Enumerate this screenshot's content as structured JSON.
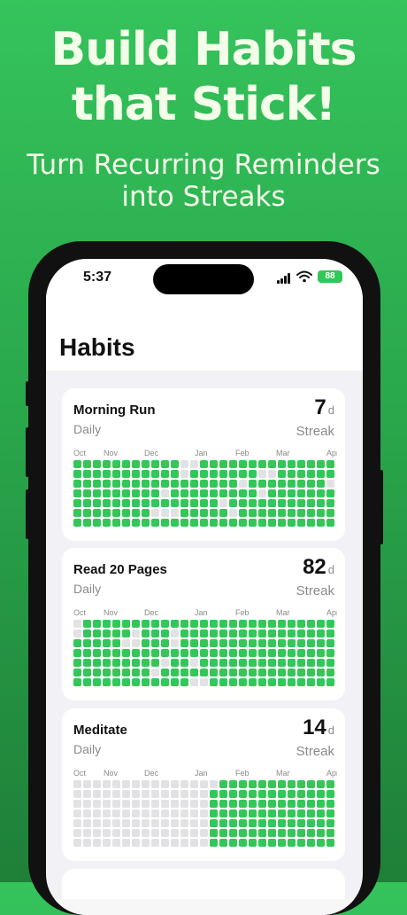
{
  "promo": {
    "headline_line1": "Build Habits",
    "headline_line2": "that Stick!",
    "subhead_line1": "Turn Recurring Reminders",
    "subhead_line2": "into Streaks"
  },
  "status_bar": {
    "time": "5:37",
    "battery": "88",
    "icons": [
      "cellular-signal-icon",
      "wifi-icon",
      "battery-icon"
    ]
  },
  "screen": {
    "title": "Habits"
  },
  "colors": {
    "accent": "#33c759",
    "empty_cell": "#e2e2e4",
    "background": "#2aa84c"
  },
  "month_labels": [
    "Oct",
    "Nov",
    "Dec",
    "Jan",
    "Feb",
    "Mar",
    "Apr"
  ],
  "habits": [
    {
      "name": "Morning Run",
      "frequency": "Daily",
      "streak_value": "7",
      "streak_unit": "d",
      "streak_label": "Streak",
      "grid": [
        "111111111110011111111111111",
        "111111111110111111100111111",
        "111111111111111110111111110",
        "111111111011111111101111111",
        "111111111111111011111111111",
        "111111110001111101111111111",
        "111111111111111111111111111"
      ]
    },
    {
      "name": "Read 20 Pages",
      "frequency": "Daily",
      "streak_value": "82",
      "streak_unit": "d",
      "streak_label": "Streak",
      "grid": [
        "011111111111111111111111111",
        "011111011101111111111111111",
        "111110011101111111111111111",
        "111111111111111111111111111",
        "111111111011011111111111111",
        "111111110111111111111111111",
        "111111111111001111111111111"
      ]
    },
    {
      "name": "Meditate",
      "frequency": "Daily",
      "streak_value": "14",
      "streak_unit": "d",
      "streak_label": "Streak",
      "grid": [
        "000000000000000111111111111",
        "000000000000001111111111111",
        "000000000000001111111111111",
        "000000000000001111111111111",
        "000000000000001111111111111",
        "000000000000001111111111111",
        "000000000000001111111111111"
      ]
    }
  ]
}
